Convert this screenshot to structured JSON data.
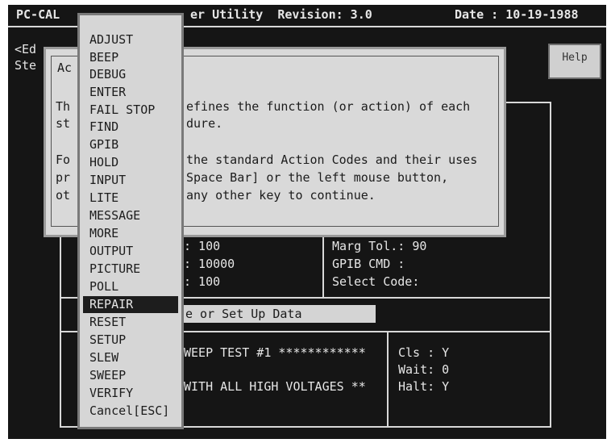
{
  "header": {
    "app": "PC-CAL",
    "title": "er Utility  Revision: 3.0",
    "date": "Date : 10-19-1988"
  },
  "left_edge": {
    "line1": "<Ed",
    "line2": "Ste"
  },
  "help_button": "Help",
  "help_dialog": {
    "title_frag": "Ac",
    "left_col": [
      "Th",
      "st",
      "",
      "Fo",
      "pr",
      "ot"
    ],
    "lines": [
      "efines the function (or action) of each",
      "dure.",
      "",
      "the standard Action Codes and their uses",
      "Space Bar] or the left mouse button,",
      "any other key to continue."
    ]
  },
  "fields": {
    "val1": ": 100",
    "val2": ": 10000",
    "val3": ": 100",
    "marg_tol": "Marg Tol.: 90",
    "gpib_cmd": "GPIB CMD :",
    "select_code": "Select Code:"
  },
  "prompt_bar": "e or Set Up Data",
  "test_lines": [
    "WEEP TEST #1 ************",
    "WITH ALL HIGH VOLTAGES **"
  ],
  "status": {
    "cls": "Cls : Y",
    "wait": "Wait: 0",
    "halt": "Halt: Y"
  },
  "menu": {
    "items": [
      "ADJUST",
      "BEEP",
      "DEBUG",
      "ENTER",
      "FAIL STOP",
      "FIND",
      "GPIB",
      "HOLD",
      "INPUT",
      "LITE",
      "MESSAGE",
      "MORE",
      "OUTPUT",
      "PICTURE",
      "POLL",
      "REPAIR",
      "RESET",
      "SETUP",
      "SLEW",
      "SWEEP",
      "VERIFY",
      "Cancel[ESC]"
    ],
    "selected": "REPAIR"
  }
}
